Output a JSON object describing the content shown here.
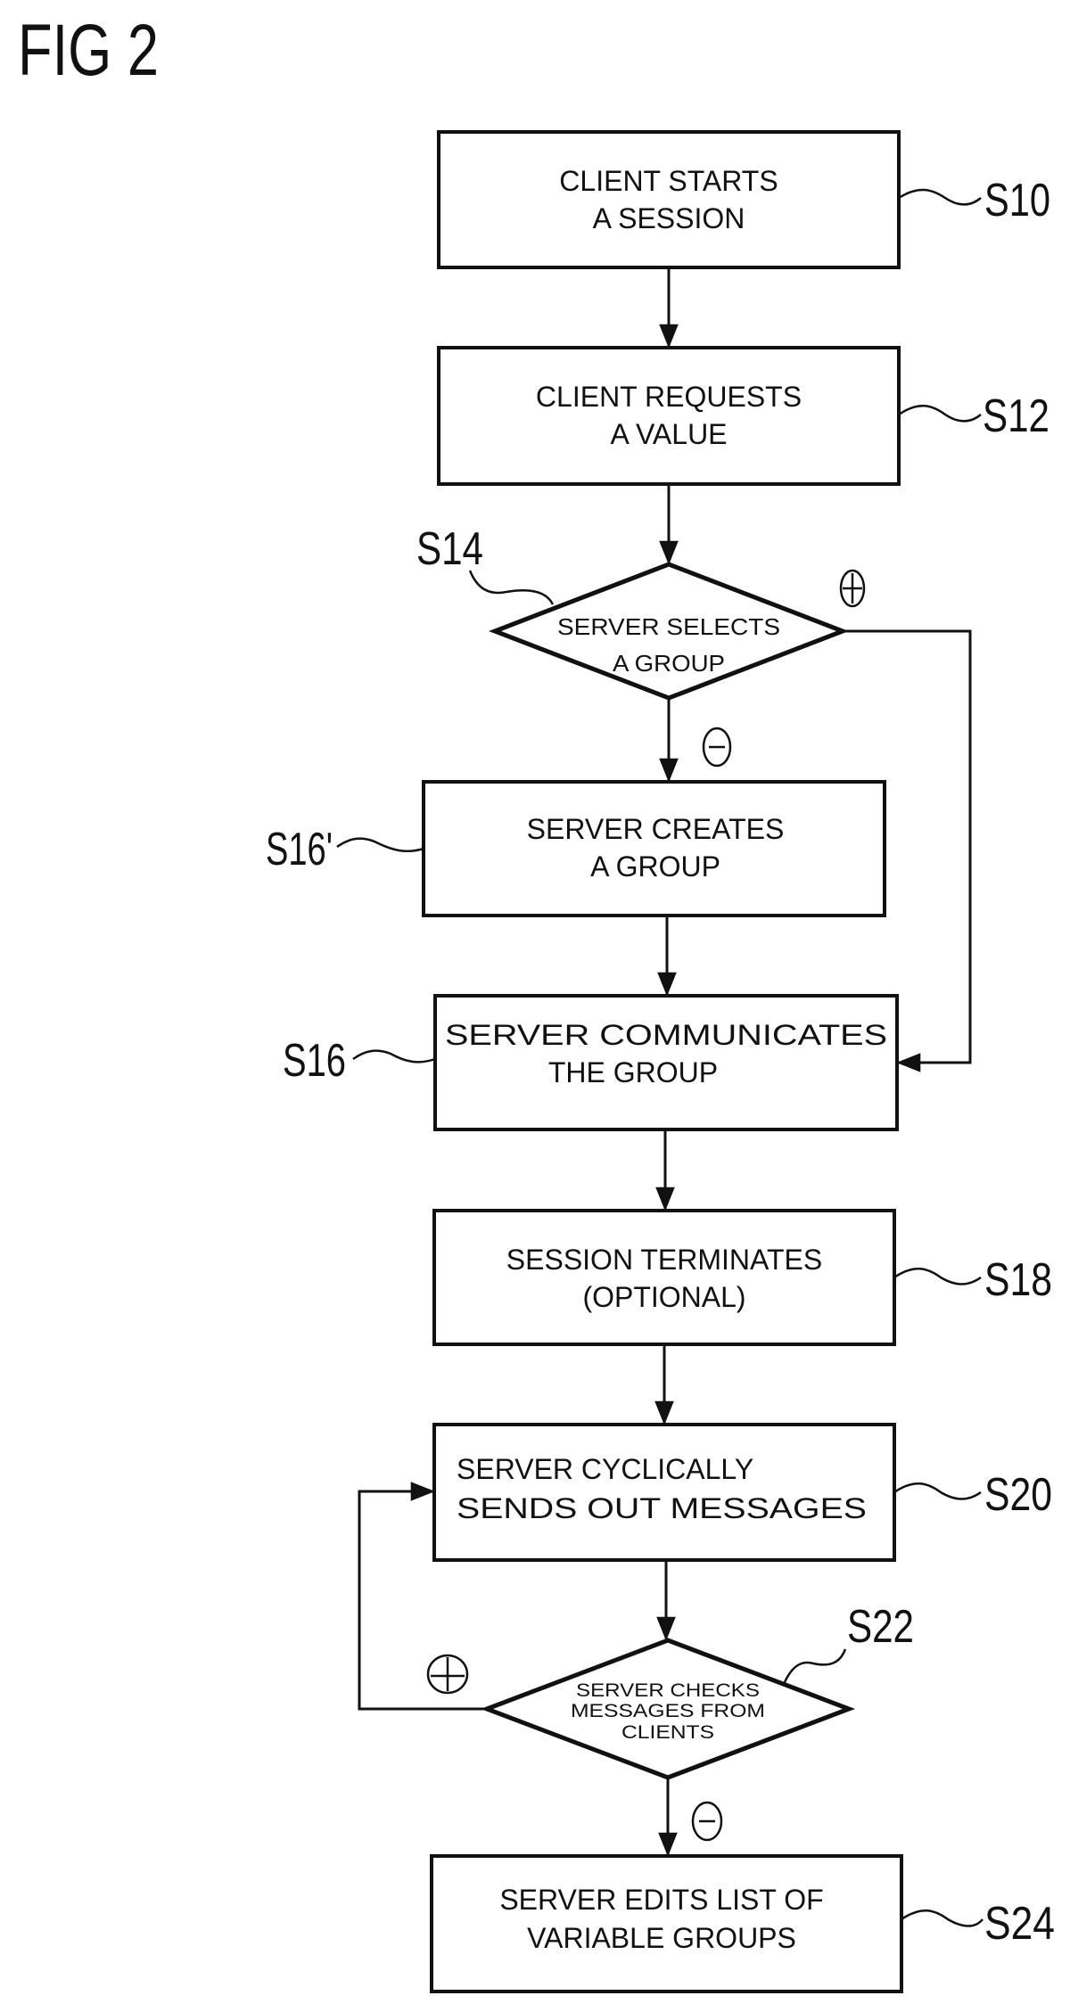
{
  "figure": {
    "title": "FIG 2"
  },
  "steps": {
    "s10": {
      "ref": "S10",
      "lines": [
        "CLIENT STARTS",
        "A  SESSION"
      ]
    },
    "s12": {
      "ref": "S12",
      "lines": [
        "CLIENT REQUESTS",
        "A VALUE"
      ]
    },
    "s14": {
      "ref": "S14",
      "lines": [
        "SERVER SELECTS",
        "A GROUP"
      ],
      "yes_sign": "+",
      "no_sign": "−"
    },
    "s16p": {
      "ref": "S16'",
      "lines": [
        "SERVER CREATES",
        "A GROUP"
      ]
    },
    "s16": {
      "ref": "S16",
      "lines": [
        "SERVER COMMUNICATES",
        "THE GROUP"
      ]
    },
    "s18": {
      "ref": "S18",
      "lines": [
        "SESSION TERMINATES",
        "(OPTIONAL)"
      ]
    },
    "s20": {
      "ref": "S20",
      "lines": [
        "SERVER CYCLICALLY",
        "SENDS OUT MESSAGES"
      ]
    },
    "s22": {
      "ref": "S22",
      "lines": [
        "SERVER CHECKS",
        "MESSAGES FROM",
        "CLIENTS"
      ],
      "yes_sign": "+",
      "no_sign": "−"
    },
    "s24": {
      "ref": "S24",
      "lines": [
        "SERVER EDITS LIST OF",
        "VARIABLE GROUPS"
      ]
    }
  },
  "flow": [
    {
      "from": "S10",
      "to": "S12"
    },
    {
      "from": "S12",
      "to": "S14"
    },
    {
      "from": "S14",
      "to": "S16'",
      "condition": "−"
    },
    {
      "from": "S14",
      "to": "S16",
      "condition": "+"
    },
    {
      "from": "S16'",
      "to": "S16"
    },
    {
      "from": "S16",
      "to": "S18"
    },
    {
      "from": "S18",
      "to": "S20"
    },
    {
      "from": "S20",
      "to": "S22"
    },
    {
      "from": "S22",
      "to": "S20",
      "condition": "+"
    },
    {
      "from": "S22",
      "to": "S24",
      "condition": "−"
    }
  ]
}
